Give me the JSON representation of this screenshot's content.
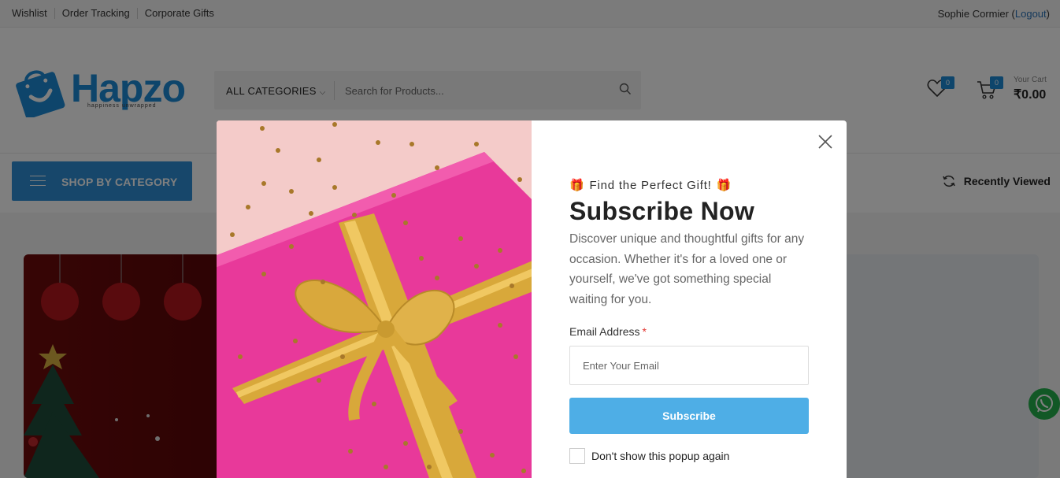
{
  "topbar": {
    "links": [
      "Wishlist",
      "Order Tracking",
      "Corporate Gifts"
    ],
    "user_name": "Sophie Cormier",
    "logout_label": "Logout"
  },
  "header": {
    "logo_text": "Hapzo",
    "logo_tagline": "happiness unwrapped",
    "category_select": "ALL CATEGORIES",
    "search_placeholder": "Search for Products...",
    "wishlist_count": "0",
    "cart_count": "0",
    "cart_label": "Your Cart",
    "cart_total": "₹0.00"
  },
  "nav": {
    "shop_by_category": "SHOP BY CATEGORY",
    "recently_viewed": "Recently Viewed"
  },
  "popup": {
    "eyebrow": "Find the Perfect Gift!",
    "title": "Subscribe Now",
    "description": "Discover unique and thoughtful gifts for any occasion. Whether it's for a loved one or yourself, we've got something special waiting for you.",
    "email_label": "Email Address",
    "email_required_mark": "*",
    "email_placeholder": "Enter Your Email",
    "subscribe_label": "Subscribe",
    "dont_show_label": "Don't show this popup again"
  },
  "colors": {
    "brand_blue": "#1d8ad6",
    "subscribe_blue": "#4eaee6",
    "gift_pink": "#e8399a",
    "ribbon_gold": "#d8a83a",
    "whatsapp_green": "#25b14d"
  },
  "icons": [
    "shopping-bag-icon",
    "chevron-down-icon",
    "search-icon",
    "heart-icon",
    "cart-icon",
    "hamburger-icon",
    "refresh-icon",
    "close-icon",
    "gift-emoji-icon",
    "whatsapp-icon"
  ]
}
